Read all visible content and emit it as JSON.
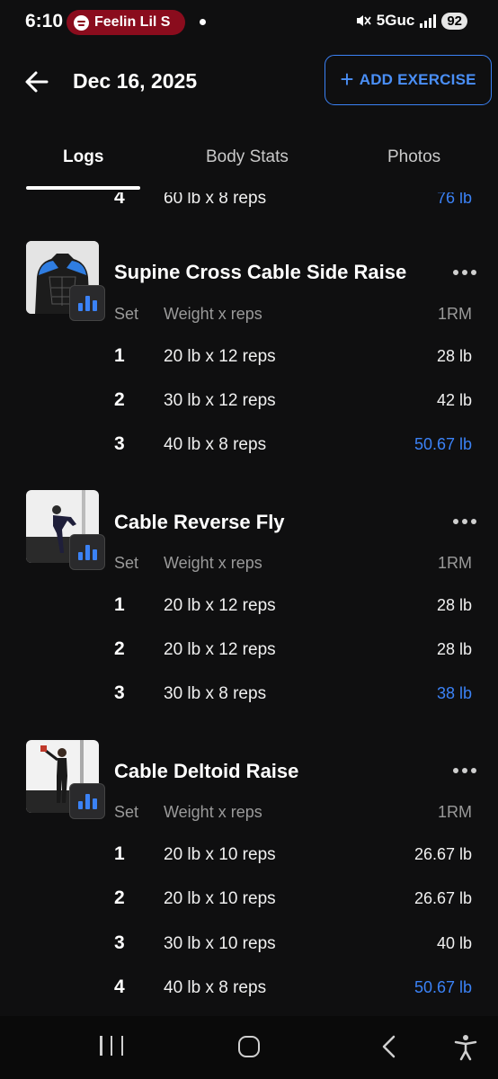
{
  "status": {
    "time": "6:10",
    "now_playing": "Feelin Lil S",
    "network": "5Guc",
    "battery": "92"
  },
  "header": {
    "date": "Dec 16, 2025",
    "add_button": "ADD EXERCISE"
  },
  "tabs": [
    {
      "label": "Logs",
      "active": true
    },
    {
      "label": "Body Stats",
      "active": false
    },
    {
      "label": "Photos",
      "active": false
    }
  ],
  "prev_row": {
    "set": "4",
    "weight_reps": "60 lb x 8 reps",
    "one_rm": "76 lb"
  },
  "columns": {
    "set": "Set",
    "weight_reps": "Weight x reps",
    "one_rm": "1RM"
  },
  "exercises": [
    {
      "name": "Supine Cross Cable Side Raise",
      "rows": [
        {
          "set": "1",
          "weight_reps": "20 lb x 12 reps",
          "one_rm": "28 lb",
          "best": false
        },
        {
          "set": "2",
          "weight_reps": "30 lb x 12 reps",
          "one_rm": "42 lb",
          "best": false
        },
        {
          "set": "3",
          "weight_reps": "40 lb x 8 reps",
          "one_rm": "50.67 lb",
          "best": true
        }
      ]
    },
    {
      "name": "Cable Reverse Fly",
      "rows": [
        {
          "set": "1",
          "weight_reps": "20 lb x 12 reps",
          "one_rm": "28 lb",
          "best": false
        },
        {
          "set": "2",
          "weight_reps": "20 lb x 12 reps",
          "one_rm": "28 lb",
          "best": false
        },
        {
          "set": "3",
          "weight_reps": "30 lb x 8 reps",
          "one_rm": "38 lb",
          "best": true
        }
      ]
    },
    {
      "name": "Cable Deltoid Raise",
      "rows": [
        {
          "set": "1",
          "weight_reps": "20 lb x 10 reps",
          "one_rm": "26.67 lb",
          "best": false
        },
        {
          "set": "2",
          "weight_reps": "20 lb x 10 reps",
          "one_rm": "26.67 lb",
          "best": false
        },
        {
          "set": "3",
          "weight_reps": "30 lb x 10 reps",
          "one_rm": "40 lb",
          "best": false
        },
        {
          "set": "4",
          "weight_reps": "40 lb x 8 reps",
          "one_rm": "50.67 lb",
          "best": true
        }
      ]
    }
  ],
  "colors": {
    "accent": "#3b82f6",
    "background": "#0f0f10",
    "spotify_pill": "#8a0c1d"
  }
}
